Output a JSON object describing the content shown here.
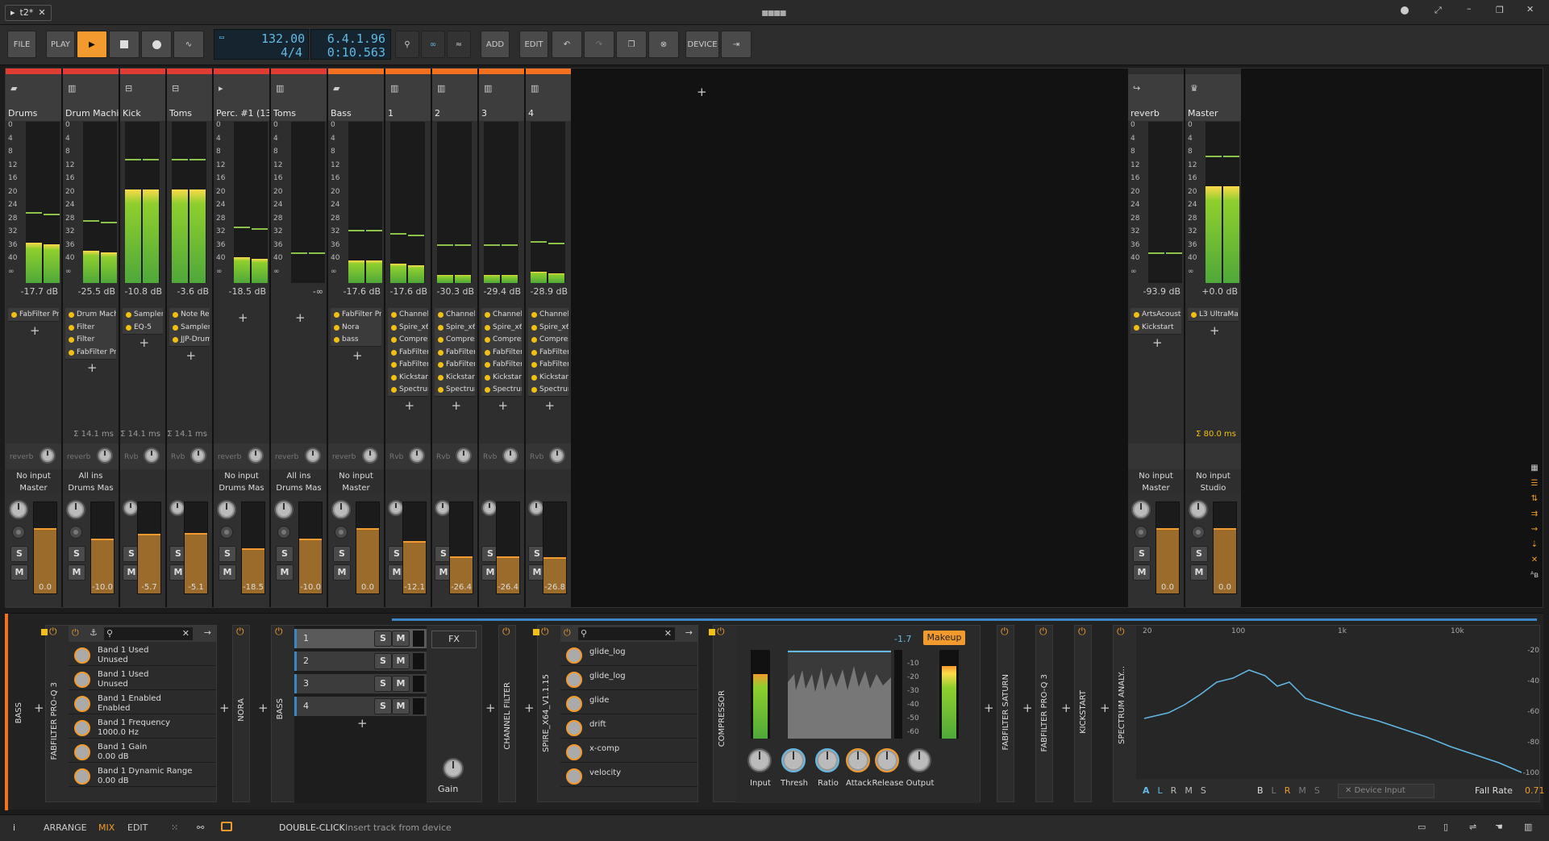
{
  "titlebar": {
    "tab_label": "t2*"
  },
  "toolbar": {
    "file": "FILE",
    "play": "PLAY",
    "tempo": "132.00",
    "signature": "4/4",
    "position": "6.4.1.96",
    "time": "0:10.563",
    "add": "ADD",
    "edit": "EDIT",
    "device": "DEVICE"
  },
  "tracks": [
    {
      "name": "Drums",
      "db": "-17.7 dB",
      "devices": [
        "FabFilter Pro-Q 3"
      ],
      "send": "reverb",
      "input": "No input",
      "output": "Master",
      "volume": "0.0",
      "latency": ""
    },
    {
      "name": "Drum Machine",
      "db": "-25.5 dB",
      "devices": [
        "Drum Machine",
        "Filter",
        "Filter",
        "FabFilter Pro-Q 3"
      ],
      "send": "reverb",
      "input": "All ins",
      "output": "Drums Mas",
      "volume": "-10.0",
      "latency": "Σ 14.1 ms"
    },
    {
      "name": "Kick",
      "db": "-10.8 dB",
      "devices": [
        "Sampler",
        "EQ-5"
      ],
      "send": "Rvb",
      "input": "",
      "output": "",
      "volume": "-5.7",
      "latency": "Σ 14.1 ms"
    },
    {
      "name": "Toms",
      "db": "-3.6 dB",
      "devices": [
        "Note Recei...",
        "Sampler",
        "JJP-Drums ..."
      ],
      "send": "Rvb",
      "input": "",
      "output": "",
      "volume": "-5.1",
      "latency": "Σ 14.1 ms"
    },
    {
      "name": "Perc. #1 (132b...",
      "db": "-18.5 dB",
      "devices": [],
      "send": "reverb",
      "input": "No input",
      "output": "Drums Mas",
      "volume": "-18.5",
      "latency": ""
    },
    {
      "name": "Toms",
      "db": "-∞",
      "devices": [],
      "send": "reverb",
      "input": "All ins",
      "output": "Drums Mas",
      "volume": "-10.0",
      "latency": ""
    },
    {
      "name": "Bass",
      "db": "-17.6 dB",
      "devices": [
        "FabFilter Pro-Q 3",
        "Nora",
        "bass"
      ],
      "send": "reverb",
      "input": "No input",
      "output": "Master",
      "volume": "0.0",
      "latency": ""
    },
    {
      "name": "1",
      "db": "-17.6 dB",
      "devices": [
        "Channel Fil...",
        "Spire_x64_...",
        "Compressor",
        "FabFilter Sa...",
        "FabFilter Pr...",
        "Kickstart",
        "Spectrum A..."
      ],
      "send": "Rvb",
      "input": "",
      "output": "",
      "volume": "-12.1",
      "latency": ""
    },
    {
      "name": "2",
      "db": "-30.3 dB",
      "devices": [
        "Channel Fil...",
        "Spire_x64_...",
        "Compressor",
        "FabFilter Sa...",
        "FabFilter Pr...",
        "Kickstart",
        "Spectrum A..."
      ],
      "send": "Rvb",
      "input": "",
      "output": "",
      "volume": "-26.4",
      "latency": ""
    },
    {
      "name": "3",
      "db": "-29.4 dB",
      "devices": [
        "Channel Fil...",
        "Spire_x64_...",
        "Compressor",
        "FabFilter Sa...",
        "FabFilter Pr...",
        "Kickstart",
        "Spectrum A..."
      ],
      "send": "Rvb",
      "input": "",
      "output": "",
      "volume": "-26.4",
      "latency": ""
    },
    {
      "name": "4",
      "db": "-28.9 dB",
      "devices": [
        "Channel Fil...",
        "Spire_x64_...",
        "Compressor",
        "FabFilter Sa...",
        "FabFilter Pr...",
        "Kickstart",
        "Spectrum A..."
      ],
      "send": "Rvb",
      "input": "",
      "output": "",
      "volume": "-26.8",
      "latency": ""
    }
  ],
  "fx_tracks": [
    {
      "name": "reverb",
      "db": "-93.9 dB",
      "devices": [
        "ArtsAcoustic R...",
        "Kickstart"
      ],
      "input": "No input",
      "output": "Master",
      "volume": "0.0",
      "latency": ""
    },
    {
      "name": "Master",
      "db": "+0.0 dB",
      "devices": [
        "L3 UltraMaximi..."
      ],
      "input": "No input",
      "output": "Studio",
      "volume": "0.0",
      "latency": "Σ 80.0 ms"
    }
  ],
  "meter_scale": [
    "0",
    "4",
    "8",
    "12",
    "16",
    "20",
    "24",
    "28",
    "32",
    "36",
    "40",
    "∞"
  ],
  "strip_buttons": {
    "solo": "S",
    "mute": "M"
  },
  "device_panel": {
    "track_label": "BASS",
    "chain": [
      "FABFILTER PRO-Q 3",
      "NORA",
      "BASS",
      "CHANNEL FILTER",
      "SPIRE_X64_V1.1.15",
      "COMPRESSOR",
      "FABFILTER SATURN",
      "FABFILTER PRO-Q 3",
      "KICKSTART",
      "SPECTRUM ANALY..."
    ],
    "proq_params": [
      {
        "name": "Band 1 Used",
        "value": "Unused"
      },
      {
        "name": "Band 1 Used",
        "value": "Unused"
      },
      {
        "name": "Band 1 Enabled",
        "value": "Enabled"
      },
      {
        "name": "Band 1 Frequency",
        "value": "1000.0 Hz"
      },
      {
        "name": "Band 1 Gain",
        "value": "0.00 dB"
      },
      {
        "name": "Band 1 Dynamic Range",
        "value": "0.00 dB"
      }
    ],
    "layers": [
      "1",
      "2",
      "3",
      "4"
    ],
    "fx_label": "FX",
    "gain_label": "Gain",
    "spire_params": [
      "glide_log",
      "glide_log",
      "glide",
      "drift",
      "x-comp",
      "velocity"
    ],
    "compressor": {
      "value": "-1.7",
      "makeup": "Makeup",
      "scale": [
        "-10",
        "-20",
        "-30",
        "-40",
        "-50",
        "-60"
      ],
      "knobs": [
        "Input",
        "Thresh",
        "Ratio",
        "Attack",
        "Release",
        "Output"
      ]
    },
    "spectrum": {
      "freqs": [
        "20",
        "100",
        "1k",
        "10k"
      ],
      "db": [
        "-20",
        "-40",
        "-60",
        "-80",
        "-100"
      ],
      "modes_a": [
        "A",
        "L",
        "R",
        "M",
        "S"
      ],
      "modes_b": [
        "B",
        "L",
        "R",
        "M",
        "S"
      ],
      "input": "Device Input",
      "fall_label": "Fall Rate",
      "fall_value": "0.71"
    }
  },
  "statusbar": {
    "arrange": "ARRANGE",
    "mix": "MIX",
    "edit": "EDIT",
    "hint_key": "DOUBLE-CLICK",
    "hint_text": "Insert track from device"
  },
  "colors": {
    "accent": "#f29a2e",
    "drums": "#e03c31",
    "bass": "#f27121",
    "meter_green": "#8fcf2d"
  }
}
